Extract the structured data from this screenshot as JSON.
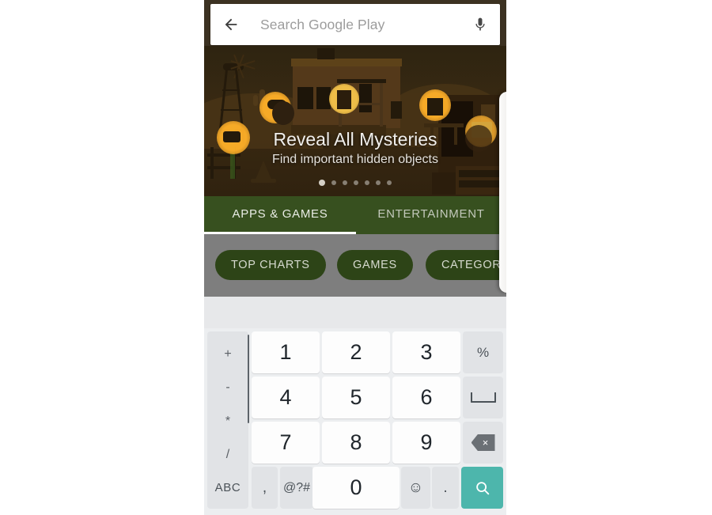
{
  "search": {
    "placeholder": "Search Google Play",
    "value": "",
    "back_icon": "back-arrow-icon",
    "mic_icon": "microphone-icon"
  },
  "banner": {
    "title": "Reveal All Mysteries",
    "subtitle": "Find important hidden objects",
    "dot_count": 7,
    "active_dot": 0,
    "theme_color": "#3a2a12"
  },
  "tabs": {
    "items": [
      {
        "label": "APPS & GAMES",
        "active": true
      },
      {
        "label": "ENTERTAINMENT",
        "active": false
      }
    ],
    "bar_color": "#37501f"
  },
  "chips": {
    "items": [
      {
        "label": "TOP CHARTS"
      },
      {
        "label": "GAMES"
      },
      {
        "label": "CATEGORIES"
      }
    ],
    "chip_color": "#2d4417",
    "bar_color": "#7e7e7e"
  },
  "keyboard": {
    "operators": [
      "+",
      "-",
      "*",
      "/"
    ],
    "numbers": [
      [
        "1",
        "2",
        "3"
      ],
      [
        "4",
        "5",
        "6"
      ],
      [
        "7",
        "8",
        "9"
      ]
    ],
    "functions": {
      "percent": "%",
      "space_icon": "space-bar-icon",
      "backspace_icon": "backspace-icon",
      "backspace_glyph": "×"
    },
    "bottom_row": {
      "abc": "ABC",
      "comma": ",",
      "symbols": "@?#",
      "zero": "0",
      "emoji_icon": "emoji-smiley-icon",
      "emoji_glyph": "☺",
      "period": ".",
      "search_icon": "search-icon"
    },
    "enter_color": "#4db6ac",
    "background_color": "#eceef0"
  }
}
